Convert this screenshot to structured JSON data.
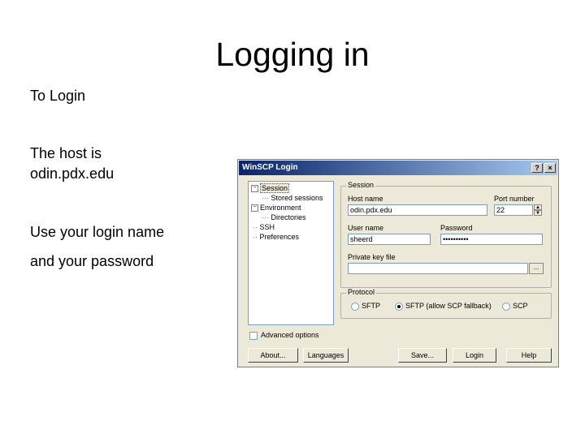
{
  "slide": {
    "title": "Logging in",
    "bullets": [
      "To Login",
      "The host is odin.pdx.edu",
      "Use your login name",
      "and your password"
    ]
  },
  "window": {
    "title": "WinSCP Login",
    "help_glyph": "?",
    "close_glyph": "×",
    "tree": [
      {
        "label": "Session",
        "expander": "−"
      },
      {
        "label": "Stored sessions"
      },
      {
        "label": "Environment",
        "expander": "−"
      },
      {
        "label": "Directories"
      },
      {
        "label": "SSH"
      },
      {
        "label": "Preferences"
      }
    ],
    "session": {
      "legend": "Session",
      "host_label": "Host name",
      "host_value": "odin.pdx.edu",
      "port_label": "Port number",
      "port_value": "22",
      "user_label": "User name",
      "user_value": "sheerd",
      "password_label": "Password",
      "password_value": "••••••••••",
      "key_label": "Private key file",
      "key_value": "",
      "browse_label": "..."
    },
    "protocol": {
      "legend": "Protocol",
      "options": [
        "SFTP",
        "SFTP (allow SCP fallback)",
        "SCP"
      ],
      "selected": 1
    },
    "advanced_label": "Advanced options",
    "buttons": [
      "About...",
      "Languages",
      "Save...",
      "Login",
      "Help"
    ]
  }
}
